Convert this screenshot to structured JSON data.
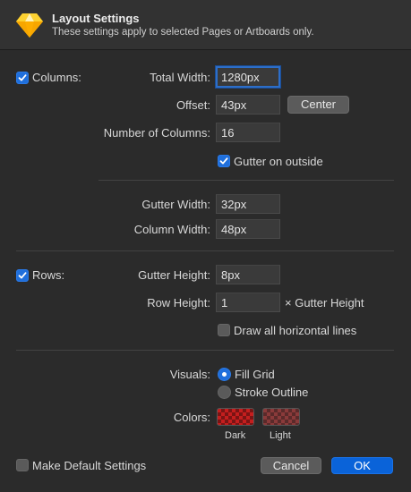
{
  "header": {
    "title": "Layout Settings",
    "subtitle": "These settings apply to selected Pages or Artboards only.",
    "logo_icon": "sketch-diamond-icon"
  },
  "columns": {
    "enabled": true,
    "label": "Columns:",
    "total_width_label": "Total Width:",
    "total_width_value": "1280px",
    "offset_label": "Offset:",
    "offset_value": "43px",
    "center_label": "Center",
    "number_label": "Number of Columns:",
    "number_value": "16",
    "gutter_outside_label": "Gutter on outside",
    "gutter_outside_checked": true,
    "gutter_width_label": "Gutter Width:",
    "gutter_width_value": "32px",
    "column_width_label": "Column Width:",
    "column_width_value": "48px"
  },
  "rows": {
    "enabled": true,
    "label": "Rows:",
    "gutter_height_label": "Gutter Height:",
    "gutter_height_value": "8px",
    "row_height_label": "Row Height:",
    "row_height_value": "1",
    "row_height_suffix": "× Gutter Height",
    "draw_lines_label": "Draw all horizontal lines",
    "draw_lines_checked": false
  },
  "visuals": {
    "label": "Visuals:",
    "fill_label": "Fill Grid",
    "stroke_label": "Stroke Outline",
    "selected": "Fill Grid"
  },
  "colors": {
    "label": "Colors:",
    "dark_label": "Dark",
    "light_label": "Light",
    "dark_color": "#c41e1e",
    "light_color": "#8a3a3a"
  },
  "footer": {
    "default_label": "Make Default Settings",
    "default_checked": false,
    "cancel_label": "Cancel",
    "ok_label": "OK"
  },
  "theme": {
    "accent": "#0a63d9",
    "background": "#2b2b2b"
  }
}
